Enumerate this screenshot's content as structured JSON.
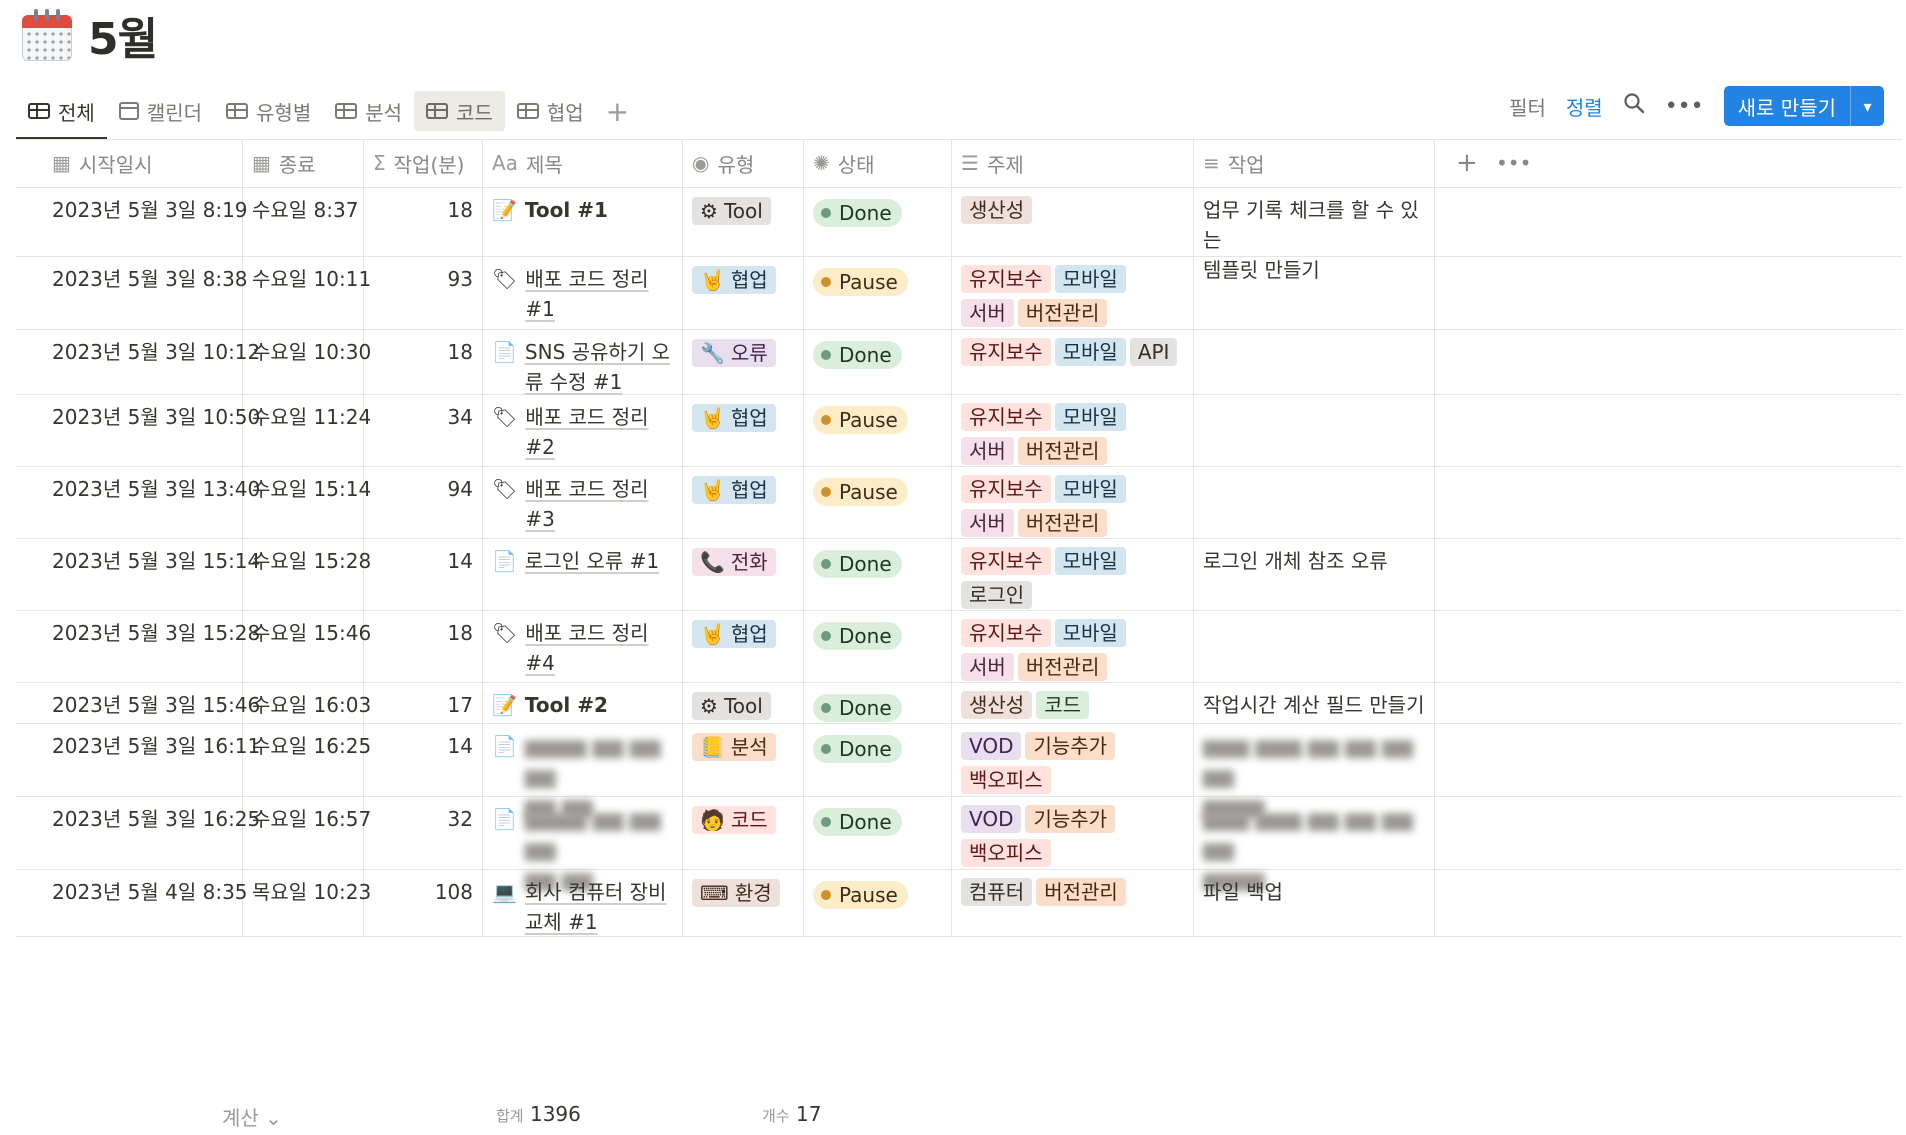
{
  "page": {
    "title": "5월"
  },
  "tabs": [
    {
      "label": "전체",
      "icon": "table-icon"
    },
    {
      "label": "캘린더",
      "icon": "calendar-icon"
    },
    {
      "label": "유형별",
      "icon": "table-icon"
    },
    {
      "label": "분석",
      "icon": "table-icon"
    },
    {
      "label": "코드",
      "icon": "table-icon"
    },
    {
      "label": "협업",
      "icon": "table-icon"
    }
  ],
  "toolbar": {
    "filter": "필터",
    "sort": "정렬",
    "search_icon": "search-icon",
    "more_icon": "more-icon",
    "new_label": "새로 만들기"
  },
  "columns": {
    "start": "시작일시",
    "end": "종료",
    "minutes": "작업(분)",
    "name": "제목",
    "type": "유형",
    "status": "상태",
    "topic": "주제",
    "work": "작업"
  },
  "colors": {
    "accent": "#2383e2",
    "done_bg": "#dbeddb",
    "done_dot": "#6c9b7d",
    "pause_bg": "#fdecc8",
    "pause_dot": "#cb912f"
  },
  "rows": [
    {
      "start": "2023년 5월 3일 8:19",
      "end": "수요일 8:37",
      "minutes": "18",
      "icon": "📝",
      "name": "Tool #1",
      "name_bold": true,
      "type": {
        "icon": "⚙",
        "label": "Tool",
        "color": "gray"
      },
      "status": "Done",
      "topics": [
        {
          "label": "생산성",
          "color": "brown"
        }
      ],
      "work": "업무 기록 체크를 할 수 있는\n템플릿 만들기"
    },
    {
      "start": "2023년 5월 3일 8:38",
      "end": "수요일 10:11",
      "minutes": "93",
      "icon": "🏷",
      "name": "배포 코드 정리 #1",
      "name_bold": false,
      "type": {
        "icon": "🤘",
        "label": "협업",
        "color": "blue"
      },
      "status": "Pause",
      "topics": [
        {
          "label": "유지보수",
          "color": "red"
        },
        {
          "label": "모바일",
          "color": "blue"
        },
        {
          "label": "서버",
          "color": "pink"
        },
        {
          "label": "버전관리",
          "color": "orange"
        }
      ],
      "work": ""
    },
    {
      "start": "2023년 5월 3일 10:12",
      "end": "수요일 10:30",
      "minutes": "18",
      "icon": "📄",
      "name": "SNS 공유하기 오류 수정 #1",
      "name_bold": false,
      "type": {
        "icon": "🔧",
        "label": "오류",
        "color": "purple"
      },
      "status": "Done",
      "topics": [
        {
          "label": "유지보수",
          "color": "red"
        },
        {
          "label": "모바일",
          "color": "blue"
        },
        {
          "label": "API",
          "color": "gray"
        }
      ],
      "work": ""
    },
    {
      "start": "2023년 5월 3일 10:50",
      "end": "수요일 11:24",
      "minutes": "34",
      "icon": "🏷",
      "name": "배포 코드 정리 #2",
      "name_bold": false,
      "type": {
        "icon": "🤘",
        "label": "협업",
        "color": "blue"
      },
      "status": "Pause",
      "topics": [
        {
          "label": "유지보수",
          "color": "red"
        },
        {
          "label": "모바일",
          "color": "blue"
        },
        {
          "label": "서버",
          "color": "pink"
        },
        {
          "label": "버전관리",
          "color": "orange"
        }
      ],
      "work": ""
    },
    {
      "start": "2023년 5월 3일 13:40",
      "end": "수요일 15:14",
      "minutes": "94",
      "icon": "🏷",
      "name": "배포 코드 정리 #3",
      "name_bold": false,
      "type": {
        "icon": "🤘",
        "label": "협업",
        "color": "blue"
      },
      "status": "Pause",
      "topics": [
        {
          "label": "유지보수",
          "color": "red"
        },
        {
          "label": "모바일",
          "color": "blue"
        },
        {
          "label": "서버",
          "color": "pink"
        },
        {
          "label": "버전관리",
          "color": "orange"
        }
      ],
      "work": ""
    },
    {
      "start": "2023년 5월 3일 15:14",
      "end": "수요일 15:28",
      "minutes": "14",
      "icon": "📄",
      "name": "로그인 오류 #1",
      "name_bold": false,
      "type": {
        "icon": "📞",
        "label": "전화",
        "color": "pink"
      },
      "status": "Done",
      "topics": [
        {
          "label": "유지보수",
          "color": "red"
        },
        {
          "label": "모바일",
          "color": "blue"
        },
        {
          "label": "로그인",
          "color": "gray"
        }
      ],
      "work": "로그인 개체 참조 오류"
    },
    {
      "start": "2023년 5월 3일 15:28",
      "end": "수요일 15:46",
      "minutes": "18",
      "icon": "🏷",
      "name": "배포 코드 정리 #4",
      "name_bold": false,
      "type": {
        "icon": "🤘",
        "label": "협업",
        "color": "blue"
      },
      "status": "Done",
      "topics": [
        {
          "label": "유지보수",
          "color": "red"
        },
        {
          "label": "모바일",
          "color": "blue"
        },
        {
          "label": "서버",
          "color": "pink"
        },
        {
          "label": "버전관리",
          "color": "orange"
        }
      ],
      "work": ""
    },
    {
      "start": "2023년 5월 3일 15:46",
      "end": "수요일 16:03",
      "minutes": "17",
      "icon": "📝",
      "name": "Tool #2",
      "name_bold": true,
      "type": {
        "icon": "⚙",
        "label": "Tool",
        "color": "gray"
      },
      "status": "Done",
      "topics": [
        {
          "label": "생산성",
          "color": "brown"
        },
        {
          "label": "코드",
          "color": "green"
        }
      ],
      "work": "작업시간 계산 필드 만들기"
    },
    {
      "start": "2023년 5월 3일 16:11",
      "end": "수요일 16:25",
      "minutes": "14",
      "icon": "📄",
      "name": "",
      "name_bold": false,
      "type": {
        "icon": "📒",
        "label": "분석",
        "color": "orange"
      },
      "status": "Done",
      "topics": [
        {
          "label": "VOD",
          "color": "purple"
        },
        {
          "label": "기능추가",
          "color": "orange"
        },
        {
          "label": "백오피스",
          "color": "red"
        }
      ],
      "work": ""
    },
    {
      "start": "2023년 5월 3일 16:25",
      "end": "수요일 16:57",
      "minutes": "32",
      "icon": "📄",
      "name": "",
      "name_bold": false,
      "type": {
        "icon": "🧑",
        "label": "코드",
        "color": "red"
      },
      "status": "Done",
      "topics": [
        {
          "label": "VOD",
          "color": "purple"
        },
        {
          "label": "기능추가",
          "color": "orange"
        },
        {
          "label": "백오피스",
          "color": "red"
        }
      ],
      "work": ""
    },
    {
      "start": "2023년 5월 4일 8:35",
      "end": "목요일 10:23",
      "minutes": "108",
      "icon": "💻",
      "name": "회사 컴퓨터 장비 교체 #1",
      "name_bold": false,
      "type": {
        "icon": "⌨",
        "label": "환경",
        "color": "brown"
      },
      "status": "Pause",
      "topics": [
        {
          "label": "컴퓨터",
          "color": "gray"
        },
        {
          "label": "버전관리",
          "color": "orange"
        }
      ],
      "work": "파일 백업"
    }
  ],
  "footer": {
    "calc": "계산",
    "sum_label": "합계",
    "sum_value": "1396",
    "count_label": "개수",
    "count_value": "17"
  }
}
